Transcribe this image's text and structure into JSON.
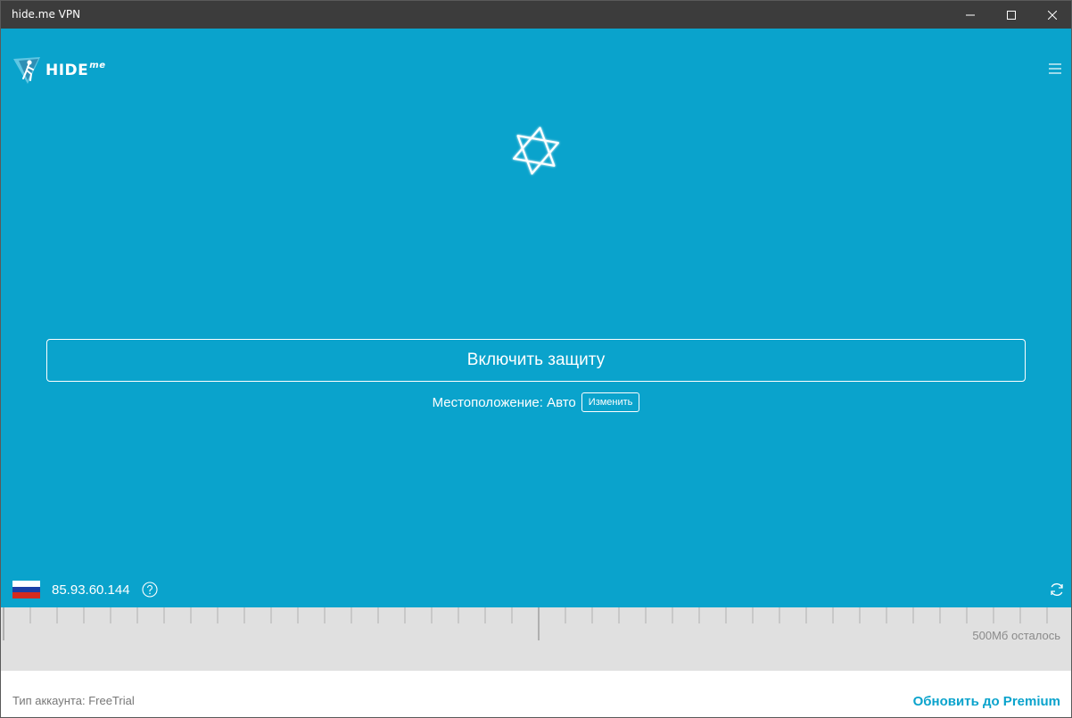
{
  "window": {
    "title": "hide.me VPN"
  },
  "brand": {
    "name": "HIDE",
    "suffix": "me"
  },
  "main": {
    "connect_label": "Включить защиту",
    "location_label": "Местоположение: Авто",
    "change_label": "Изменить",
    "ip_address": "85.93.60.144",
    "country_flag": "russia"
  },
  "usage": {
    "remaining_text": "500Мб осталось"
  },
  "footer": {
    "account_type": "Тип аккаунта: FreeTrial",
    "upgrade_label": "Обновить до Premium"
  },
  "colors": {
    "accent": "#0aa3cc",
    "titlebar": "#3c3c3c",
    "meter": "#e0e0e0"
  }
}
